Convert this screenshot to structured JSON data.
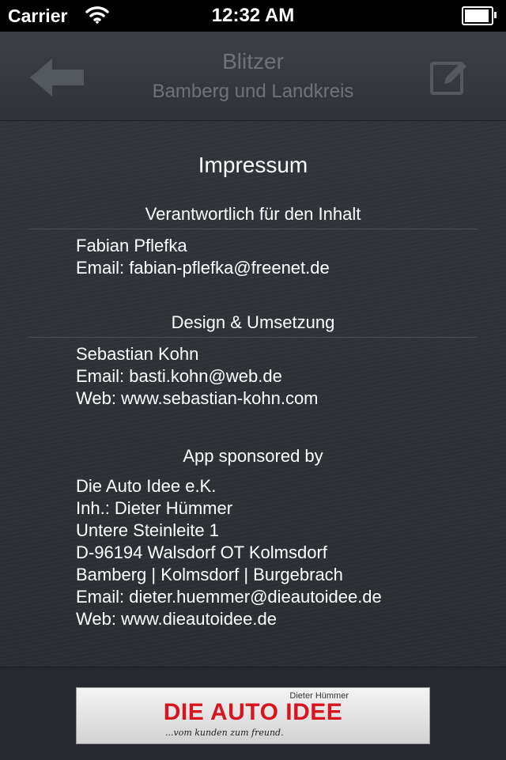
{
  "status_bar": {
    "carrier": "Carrier",
    "time": "12:32 AM"
  },
  "nav": {
    "title": "Blitzer",
    "subtitle": "Bamberg und Landkreis",
    "back_icon": "back-arrow-icon",
    "edit_icon": "compose-icon"
  },
  "page": {
    "title": "Impressum"
  },
  "sections": {
    "content": {
      "header": "Verantwortlich für den Inhalt",
      "lines": [
        "Fabian Pflefka",
        "Email: fabian-pflefka@freenet.de"
      ]
    },
    "design": {
      "header": "Design & Umsetzung",
      "lines": [
        "Sebastian Kohn",
        "Email: basti.kohn@web.de",
        "Web: www.sebastian-kohn.com"
      ]
    },
    "sponsor": {
      "header": "App sponsored by",
      "lines": [
        "Die Auto Idee e.K.",
        "Inh.: Dieter Hümmer",
        "Untere Steinleite 1",
        "D-96194 Walsdorf OT Kolmsdorf",
        "Bamberg | Kolmsdorf | Burgebrach",
        "Email: dieter.huemmer@dieautoidee.de",
        "Web: www.dieautoidee.de"
      ]
    }
  },
  "banner": {
    "owner": "Dieter Hümmer",
    "brand": "DIE AUTO IDEE",
    "slogan": "...vom kunden zum freund."
  },
  "colors": {
    "nav_text": "#6e737a",
    "banner_brand": "#d8141e"
  }
}
